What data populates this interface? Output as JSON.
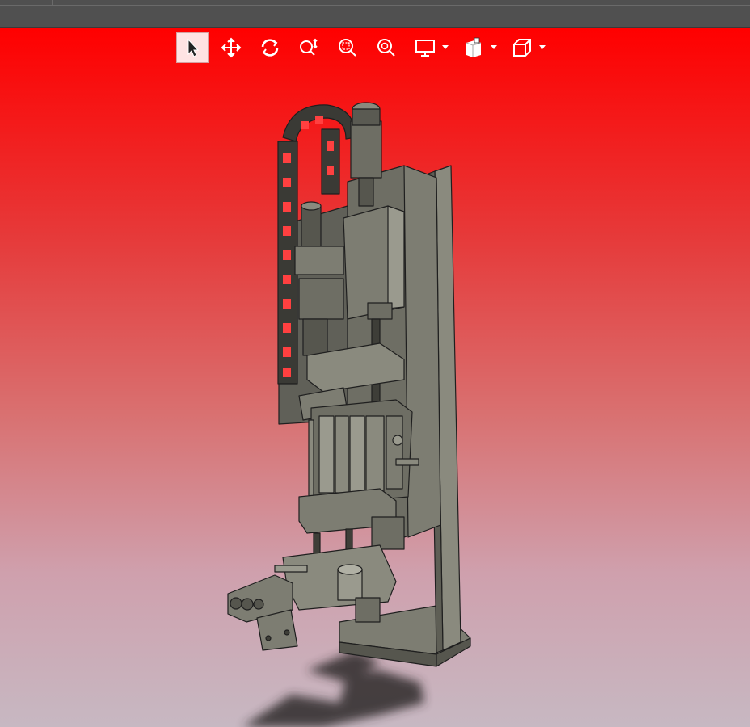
{
  "window": {
    "title_bar": {}
  },
  "toolbar": {
    "buttons": [
      {
        "name": "select",
        "icon": "pointer-icon"
      },
      {
        "name": "pan",
        "icon": "move-arrows-icon"
      },
      {
        "name": "rotate",
        "icon": "rotate-icon"
      },
      {
        "name": "zoom",
        "icon": "zoom-updown-icon"
      },
      {
        "name": "zoom-window",
        "icon": "zoom-window-icon"
      },
      {
        "name": "zoom-fit",
        "icon": "zoom-fit-icon"
      },
      {
        "name": "display",
        "icon": "monitor-icon"
      },
      {
        "name": "render-mode",
        "icon": "shaded-box-icon"
      },
      {
        "name": "view-orientation",
        "icon": "cube-icon"
      }
    ],
    "active": "select"
  },
  "viewport": {
    "background_top": "#ff0000",
    "background_bottom": "#c7b8c2",
    "model": "cad-assembly"
  },
  "colors": {
    "part": "#7d7d72",
    "part_dark": "#56564e",
    "part_light": "#9a9a8e",
    "edge": "#1f1f1f",
    "shadow": "#2e2a2c"
  }
}
